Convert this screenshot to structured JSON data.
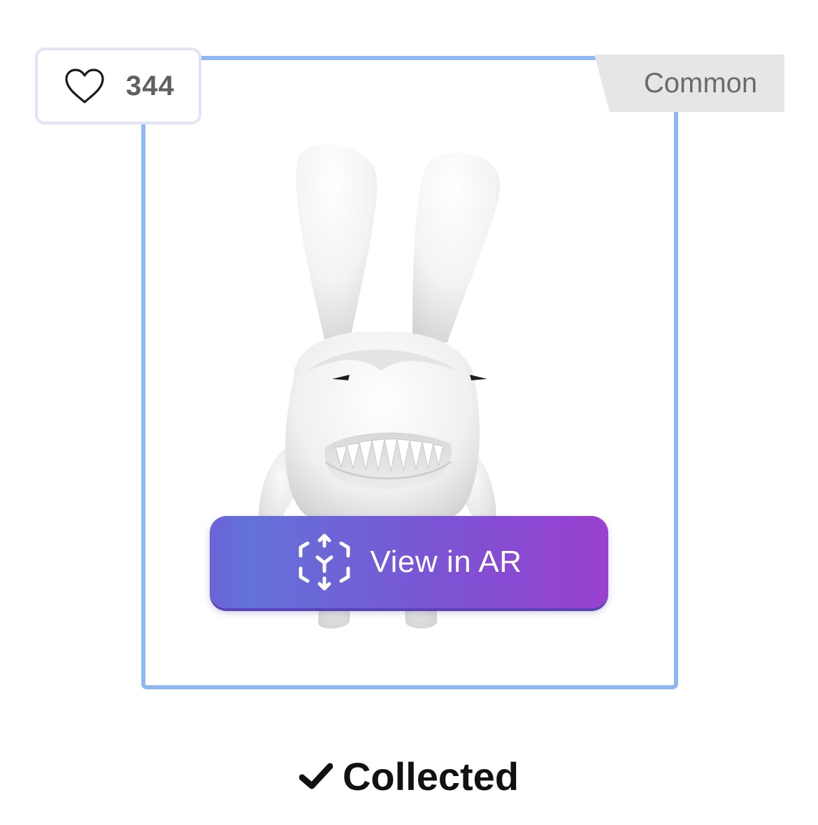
{
  "likes": {
    "icon": "heart-outline-icon",
    "count": "344"
  },
  "rarity": {
    "label": "Common"
  },
  "item": {
    "image": "white-shark-bunny-figure"
  },
  "ar_button": {
    "icon": "ar-cube-icon",
    "label": "View in AR"
  },
  "status": {
    "icon": "checkmark-icon",
    "label": "Collected"
  },
  "colors": {
    "frame_border": "#8fb8f2",
    "like_border": "#e3e3f6",
    "rarity_bg": "#e6e6e6",
    "ar_gradient_start": "#6c63d8",
    "ar_gradient_end": "#9a3fcf"
  }
}
